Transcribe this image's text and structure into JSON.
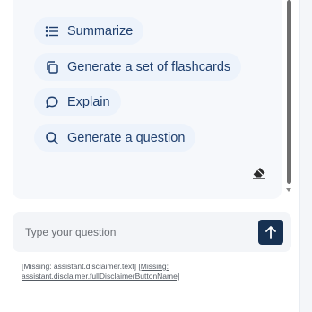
{
  "suggestions": [
    {
      "label": "Summarize",
      "icon": "list-icon"
    },
    {
      "label": "Generate a set of flashcards",
      "icon": "copy-icon"
    },
    {
      "label": "Explain",
      "icon": "speech-bubble-icon"
    },
    {
      "label": "Generate a question",
      "icon": "search-icon"
    }
  ],
  "input": {
    "placeholder": "Type your question"
  },
  "disclaimer": {
    "text": "[Missing: assistant.disclaimer.text]",
    "link": "[Missing: assistant.disclaimer.fullDisclaimerButtonName]"
  },
  "colors": {
    "accent": "#173152",
    "chip_bg": "#edf3fb",
    "chip_text": "#1f3f6e"
  }
}
